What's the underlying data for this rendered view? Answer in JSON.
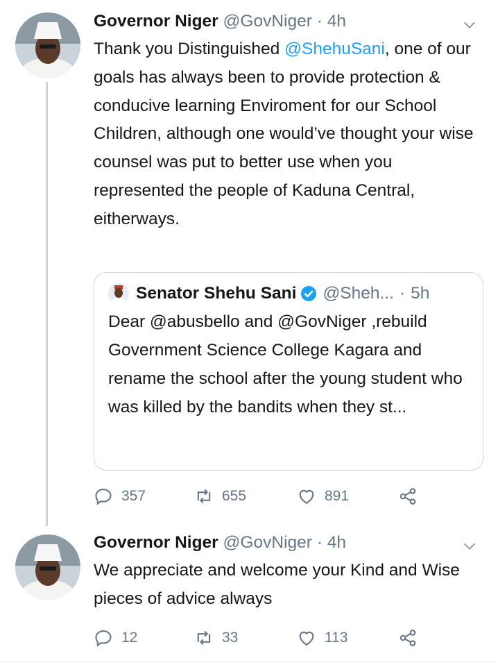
{
  "tweets": [
    {
      "name": "Governor Niger",
      "handle": "@GovNiger",
      "dot": "·",
      "time": "4h",
      "body_pre": "Thank you Distinguished ",
      "mention": "@ShehuSani",
      "body_post": ", one of our goals has always been to provide protection & conducive learning Enviroment for our School Children, although one would’ve thought your wise counsel was put to better use when you represented the people of Kaduna Central, eitherways.",
      "quote": {
        "name": "Senator Shehu Sani",
        "handle": "@Sheh...",
        "dot": "·",
        "time": "5h",
        "body": "Dear @abusbello and @GovNiger ,rebuild  Government Science College Kagara and rename the school after the young student who was killed by the bandits when they st..."
      },
      "replies": "357",
      "retweets": "655",
      "likes": "891"
    },
    {
      "name": "Governor Niger",
      "handle": "@GovNiger",
      "dot": "·",
      "time": "4h",
      "body": "We appreciate and welcome your Kind and Wise pieces of advice always",
      "replies": "12",
      "retweets": "33",
      "likes": "113"
    }
  ],
  "colors": {
    "link": "#1da1f2",
    "muted": "#657786",
    "border": "#ccd6dd",
    "verified": "#1da1f2"
  }
}
